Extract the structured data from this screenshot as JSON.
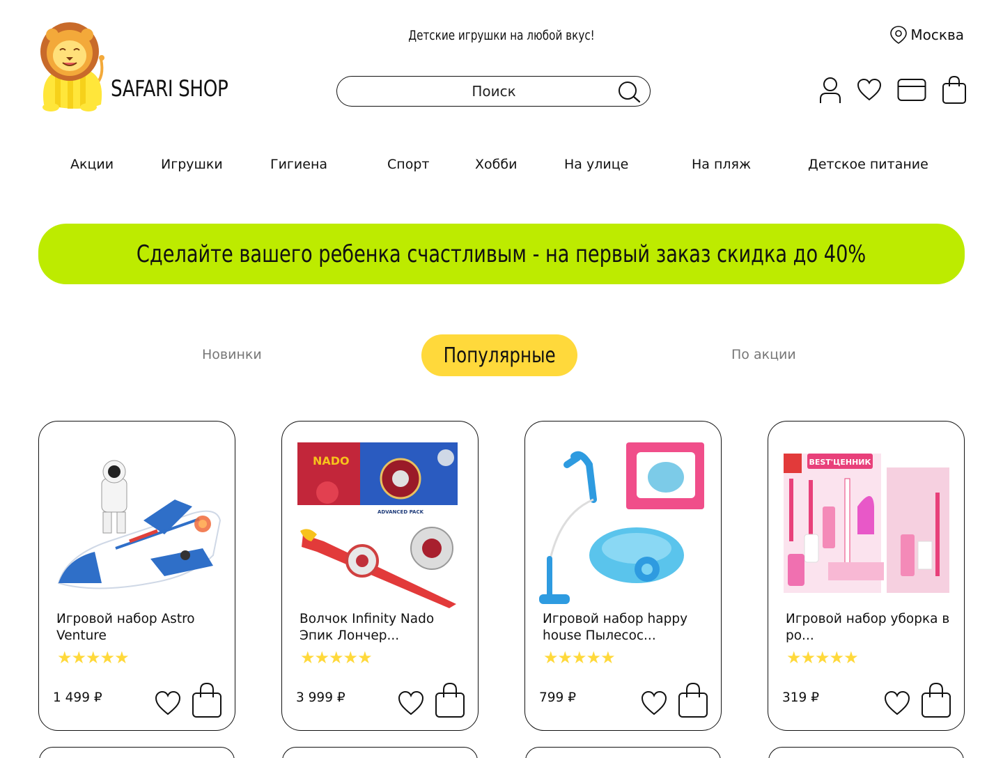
{
  "header": {
    "brand": "SAFARI SHOP",
    "tagline": "Детские игрушки на любой вкус!",
    "city": "Москва",
    "search_placeholder": "Поиск"
  },
  "nav": [
    "Акции",
    "Игрушки",
    "Гигиена",
    "Спорт",
    "Хобби",
    "На улице",
    "На пляж",
    "Детское питание"
  ],
  "promo": "Сделайте вашего ребенка счастливым - на первый заказ скидка до 40%",
  "tabs": {
    "new": "Новинки",
    "popular": "Популярные",
    "sale": "По акции",
    "active": "popular"
  },
  "products": [
    {
      "title": "Игровой набор Astro Venture",
      "rating": "★★★★★",
      "price": "1 499 ₽"
    },
    {
      "title": "Волчок Infinity Nado Эпик Лончер...",
      "rating": "★★★★★",
      "price": "3 999 ₽"
    },
    {
      "title": "Игровой набор happy house Пылесос...",
      "rating": "★★★★★",
      "price": "799 ₽"
    },
    {
      "title": "Игровой набор уборка в ро...",
      "rating": "★★★★★",
      "price": "319 ₽"
    }
  ],
  "image_texts": {
    "nado": "NADO",
    "advanced": "ADVANCED PACK",
    "best": "BEST'ЦЕННИК"
  },
  "colors": {
    "accent_green": "#BDEB00",
    "accent_yellow": "#FFD93B",
    "text": "#111111"
  }
}
